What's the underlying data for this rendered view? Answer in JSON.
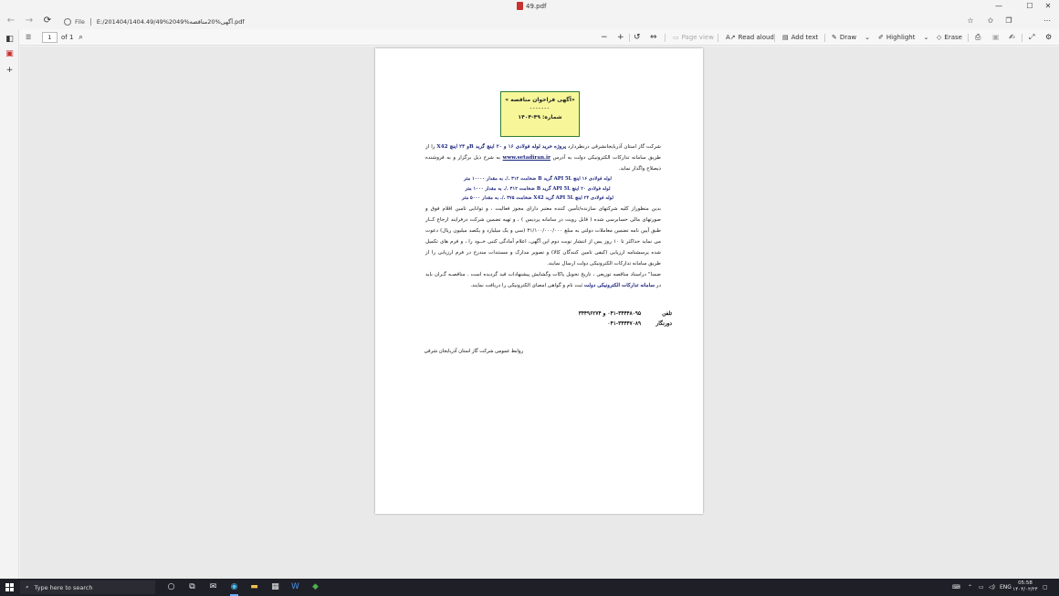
{
  "window": {
    "title": "49.pdf",
    "minimize_glyph": "—",
    "maximize_glyph": "☐",
    "close_glyph": "✕"
  },
  "browser": {
    "address_label": "File",
    "address_url": "E:/201404/1404.49/49%20آگهی%20مناقصه%49.pdf",
    "back_glyph": "←",
    "forward_glyph": "→",
    "refresh_glyph": "⟳"
  },
  "pdf_toolbar": {
    "contents_glyph": "☰",
    "page_number": "1",
    "page_total": "of 1",
    "search_glyph": "⌕",
    "zoom_out_glyph": "−",
    "zoom_in_glyph": "+",
    "rotate_glyph": "↺",
    "fit_glyph": "⇔",
    "page_view": "Page view",
    "read_aloud": "Read aloud",
    "add_text": "Add text",
    "draw": "Draw",
    "highlight": "Highlight",
    "erase": "Erase"
  },
  "document": {
    "notice_title": "«آگهی فراخوان مناقصه »",
    "notice_dashes": "-------",
    "notice_number": "شماره:   ۴۹-۱۴۰۴",
    "para1_a": "شرکت گاز استان آذربایجانشرقی درنظردارد ",
    "para1_b": "پروژه خرید لوله فولادی ۱۶ و ۲۰ اینچ گرید Bو ۲۴ اینچ X42",
    "para1_c": " را از طریق سامانه تدارکات الکترونیکی دولت به آدرس ",
    "para1_link": "www.setadiran.ir",
    "para1_d": " به شرح ذیل برگزار و به فروشنده ذیصلاح واگذار نماید.",
    "item1": "لوله فولادی ۱۶ اینچ API 5L گرید B ضخامت ۳۱۲ ./. به مقدار  ۱۰۰۰۰ متر",
    "item2": "لوله فولادی ۲۰ اینچ API 5L گرید B ضخامت ۳۱۲ ./. به مقدار  ۱۰۰۰ متر",
    "item3": "لوله فولادی ۲۴ اینچ API 5L گرید X42 ضخامت ۳۷۵ ./. به مقدار  ۵۰۰۰ متر",
    "para2": "بدین منظوراز کلیه شرکتهای سازنده/تأمین کننده معتبر دارای مجوز فعالیت ، و توانایی تامین اقلام فوق و صورتهای مالی حسابرسی شده ( قابل رویت در سامانه پردیس ) ، و تهیه تضمین شرکت درفرایند ارجاع کــار طبق آیین نامه تضمین معاملات دولتی به مبلغ ۳۱/۱۰۰/۰۰۰/۰۰۰ (سی و یک میلیارد و یکصد میلیون ریال) دعوت می نماید حداکثر تا ۱۰ روز پس از انتشار نوبت دوم این آگهی، اعلام آمادگی کتبی خــود را ، و فرم های تکمیل شده پرسشنامه ارزیابی (کیفی تامین کنندگان کالا) و تصویر مدارک و مستندات مندرج در فرم ارزیابی را از طریق سامانه تدارکات الکترونیکی دولت ارسال نمایند.",
    "para3_a": "ضمنا\" دراسناد مناقصه توزیعی ، تاریخ تحویل پاکات وگشایش پیشنهادات قید گردیده است . مناقصـه گـران باید در ",
    "para3_b": "سامانه تدارکات الکترونیکی دولت",
    "para3_c": " ثبت نام  و گواهی امضای الکترونیکی را دریافت نمایند.",
    "phone_label": "تلفن",
    "phone_value": "۰۴۱-۳۴۴۴۸۰۹۵ و ۳۴۴۹۶۲۷۴",
    "fax_label": "دورنگار",
    "fax_value": "۰۴۱-۳۴۴۴۷۰۸۹",
    "footer": "روابط عمومی شرکت گاز استان آذربایجان شرقی"
  },
  "taskbar": {
    "search_placeholder": "Type here to search",
    "language": "ENG",
    "time": "05:58",
    "date": "۱۴۰۴/۰۲/۲۴"
  },
  "colors": {
    "notice_bg": "#f7f79a",
    "notice_border": "#2e7d32",
    "doc_blue": "#1a237e",
    "taskbar_bg": "#1f1f27"
  }
}
